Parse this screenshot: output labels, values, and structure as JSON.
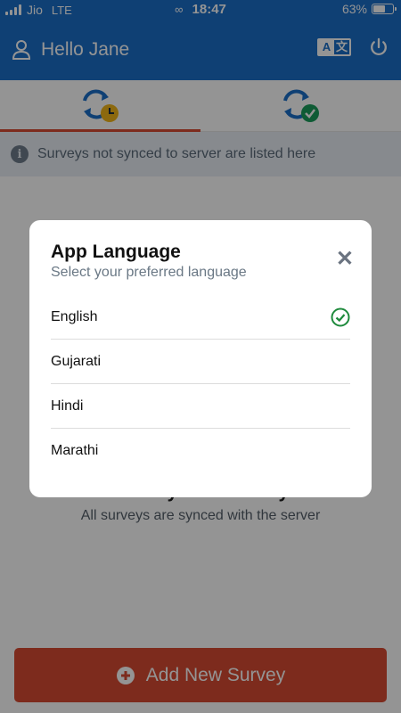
{
  "status_bar": {
    "carrier": "Jio",
    "network": "LTE",
    "time": "18:47",
    "battery_text": "63%",
    "battery_level": 0.63
  },
  "header": {
    "greeting": "Hello Jane"
  },
  "tabs": [
    {
      "name": "unsynced",
      "icon": "sync-pending-icon",
      "active": true
    },
    {
      "name": "synced",
      "icon": "sync-done-icon",
      "active": false
    }
  ],
  "info": {
    "text": "Surveys not synced to server are listed here"
  },
  "empty_state": {
    "title": "No Unsynced Surveys",
    "subtitle": "All surveys are synced with the server"
  },
  "add_button": {
    "label": "Add New Survey"
  },
  "modal": {
    "title": "App Language",
    "subtitle": "Select your preferred language",
    "options": [
      {
        "label": "English",
        "selected": true
      },
      {
        "label": "Gujarati",
        "selected": false
      },
      {
        "label": "Hindi",
        "selected": false
      },
      {
        "label": "Marathi",
        "selected": false
      }
    ]
  },
  "colors": {
    "primary": "#1a6fc9",
    "accent": "#d84a32",
    "pending": "#f2b619",
    "done": "#1a9e5c",
    "check": "#1e8a3c"
  }
}
